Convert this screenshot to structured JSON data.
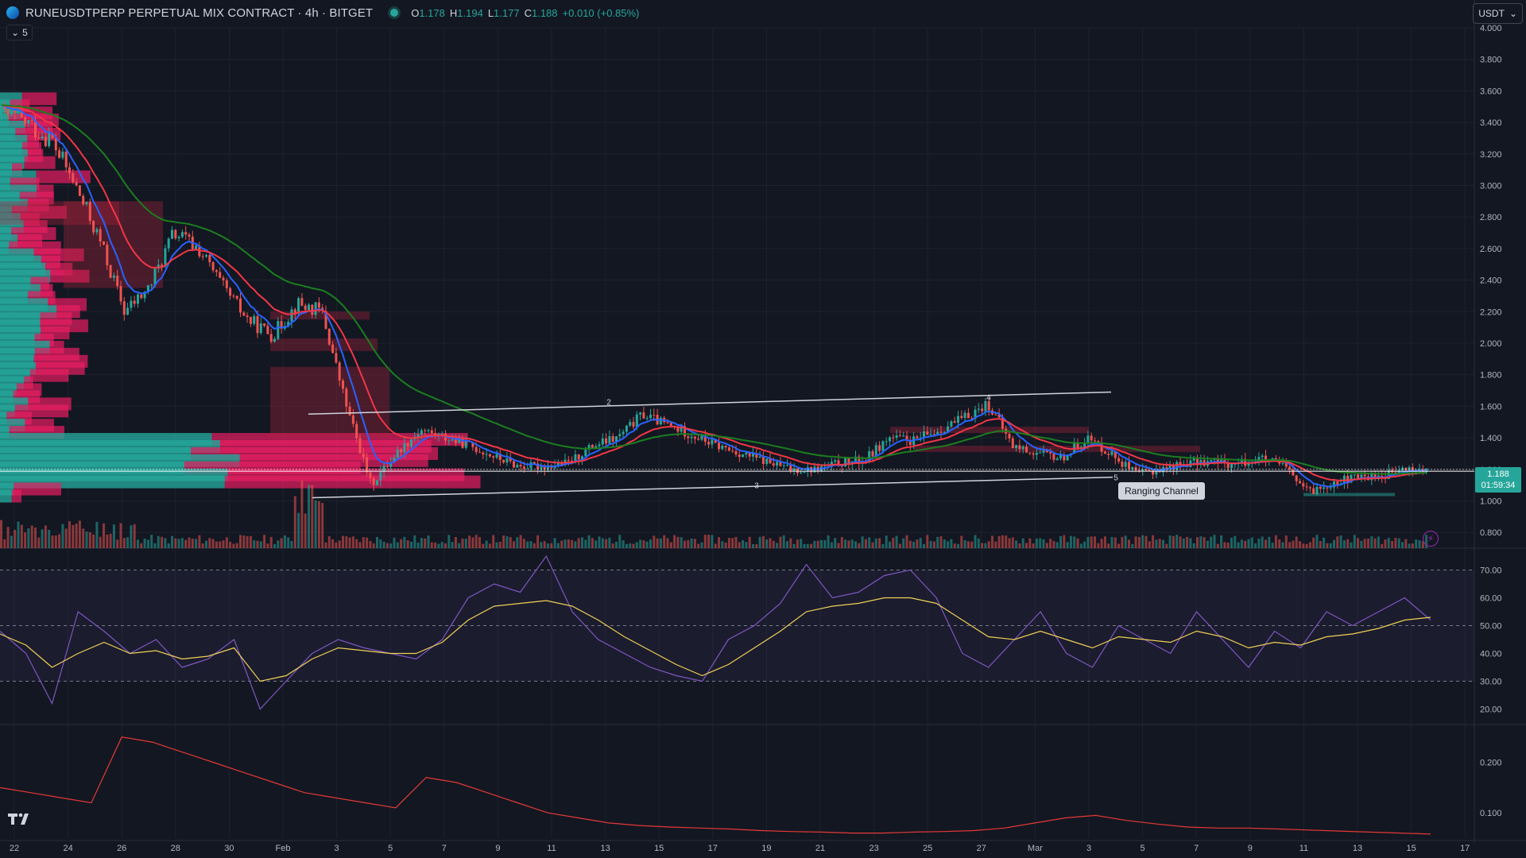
{
  "header": {
    "title": "RUNEUSDTPERP PERPETUAL MIX CONTRACT · 4h · BITGET",
    "ohlc": {
      "o_label": "O",
      "o_value": "1.178",
      "h_label": "H",
      "h_value": "1.194",
      "l_label": "L",
      "l_value": "1.177",
      "c_label": "C",
      "c_value": "1.188",
      "change": "+0.010 (+0.85%)"
    },
    "indicators_count": "5",
    "currency": "USDT"
  },
  "price_label": {
    "price": "1.188",
    "countdown": "01:59:34"
  },
  "annotation": {
    "text": "Ranging Channel"
  },
  "colors": {
    "bg": "#131722",
    "up": "#26a69a",
    "down": "#ef5350",
    "ema_fast": "#2962ff",
    "ema_mid": "#f23645",
    "ema_slow": "#1b7e1f",
    "rsi": "#7e57c2",
    "rsi_ma": "#f0d056"
  },
  "icons": [
    "tradingview-logo-icon",
    "lightning-icon",
    "chevron-down-icon"
  ],
  "chart_data": [
    {
      "type": "candlestick",
      "title": "RUNEUSDTPERP PERPETUAL MIX CONTRACT · 4h · BITGET",
      "ylim": [
        0.7,
        4.0
      ],
      "y_ticks": [
        "4.000",
        "3.800",
        "3.600",
        "3.400",
        "3.200",
        "3.000",
        "2.800",
        "2.600",
        "2.400",
        "2.200",
        "2.000",
        "1.800",
        "1.600",
        "1.400",
        "1.200",
        "1.000",
        "0.800"
      ],
      "x_ticks": [
        "22",
        "24",
        "26",
        "28",
        "30",
        "Feb",
        "3",
        "5",
        "7",
        "9",
        "11",
        "13",
        "15",
        "17",
        "19",
        "21",
        "23",
        "25",
        "27",
        "Mar",
        "3",
        "5",
        "7",
        "9",
        "11",
        "13",
        "15",
        "17"
      ],
      "wave_labels": [
        "2",
        "3",
        "4",
        "5"
      ],
      "close_path": [
        [
          0,
          3.45
        ],
        [
          1,
          3.4
        ],
        [
          2,
          3.3
        ],
        [
          3,
          3.0
        ],
        [
          4,
          2.65
        ],
        [
          5,
          2.2
        ],
        [
          6,
          2.35
        ],
        [
          7,
          2.7
        ],
        [
          8,
          2.6
        ],
        [
          9,
          2.35
        ],
        [
          10,
          2.15
        ],
        [
          11,
          2.05
        ],
        [
          12,
          2.25
        ],
        [
          13,
          2.2
        ],
        [
          14,
          1.6
        ],
        [
          15,
          1.1
        ],
        [
          16,
          1.3
        ],
        [
          17,
          1.45
        ],
        [
          18,
          1.4
        ],
        [
          19,
          1.35
        ],
        [
          20,
          1.28
        ],
        [
          21,
          1.22
        ],
        [
          22,
          1.22
        ],
        [
          23,
          1.24
        ],
        [
          24,
          1.35
        ],
        [
          25,
          1.4
        ],
        [
          26,
          1.55
        ],
        [
          27,
          1.48
        ],
        [
          28,
          1.42
        ],
        [
          29,
          1.35
        ],
        [
          30,
          1.3
        ],
        [
          31,
          1.25
        ],
        [
          32,
          1.2
        ],
        [
          33,
          1.2
        ],
        [
          34,
          1.24
        ],
        [
          35,
          1.26
        ],
        [
          36,
          1.4
        ],
        [
          37,
          1.38
        ],
        [
          38,
          1.45
        ],
        [
          39,
          1.52
        ],
        [
          40,
          1.62
        ],
        [
          41,
          1.35
        ],
        [
          42,
          1.3
        ],
        [
          43,
          1.27
        ],
        [
          44,
          1.4
        ],
        [
          45,
          1.3
        ],
        [
          46,
          1.17
        ],
        [
          47,
          1.2
        ],
        [
          48,
          1.24
        ],
        [
          49,
          1.25
        ],
        [
          50,
          1.23
        ],
        [
          51,
          1.27
        ],
        [
          52,
          1.22
        ],
        [
          53,
          1.05
        ],
        [
          54,
          1.12
        ],
        [
          55,
          1.15
        ],
        [
          56,
          1.16
        ],
        [
          57,
          1.2
        ],
        [
          58,
          1.19
        ]
      ]
    },
    {
      "type": "line",
      "title": "RSI",
      "ylim": [
        15,
        75
      ],
      "y_ticks": [
        "70.00",
        "60.00",
        "50.00",
        "40.00",
        "30.00",
        "20.00"
      ],
      "series": [
        {
          "values": [
            48,
            40,
            22,
            55,
            48,
            40,
            45,
            35,
            38,
            45,
            20,
            30,
            40,
            45,
            42,
            40,
            38,
            45,
            60,
            65,
            62,
            75,
            55,
            45,
            40,
            35,
            32,
            30,
            45,
            50,
            58,
            72,
            60,
            62,
            68,
            70,
            60,
            40,
            35,
            45,
            55,
            40,
            35,
            50,
            45,
            40,
            55,
            45,
            35,
            48,
            42,
            55,
            50,
            55,
            60,
            52
          ]
        },
        {
          "values": [
            47,
            43,
            35,
            40,
            44,
            40,
            41,
            38,
            39,
            42,
            30,
            32,
            38,
            42,
            41,
            40,
            40,
            44,
            52,
            57,
            58,
            59,
            57,
            52,
            46,
            41,
            36,
            32,
            36,
            42,
            48,
            55,
            57,
            58,
            60,
            60,
            58,
            52,
            46,
            45,
            48,
            45,
            42,
            46,
            45,
            44,
            48,
            46,
            42,
            44,
            43,
            46,
            47,
            49,
            52,
            53
          ]
        }
      ]
    },
    {
      "type": "line",
      "title": "",
      "ylim": [
        0.05,
        0.27
      ],
      "y_ticks": [
        "0.200",
        "0.100"
      ],
      "series": [
        {
          "values": [
            0.15,
            0.14,
            0.13,
            0.12,
            0.25,
            0.24,
            0.22,
            0.2,
            0.18,
            0.16,
            0.14,
            0.13,
            0.12,
            0.11,
            0.17,
            0.16,
            0.14,
            0.12,
            0.1,
            0.09,
            0.08,
            0.075,
            0.072,
            0.07,
            0.068,
            0.065,
            0.063,
            0.062,
            0.06,
            0.06,
            0.062,
            0.063,
            0.065,
            0.07,
            0.08,
            0.09,
            0.095,
            0.085,
            0.078,
            0.072,
            0.07,
            0.07,
            0.068,
            0.066,
            0.064,
            0.062,
            0.06,
            0.058
          ]
        }
      ]
    }
  ]
}
